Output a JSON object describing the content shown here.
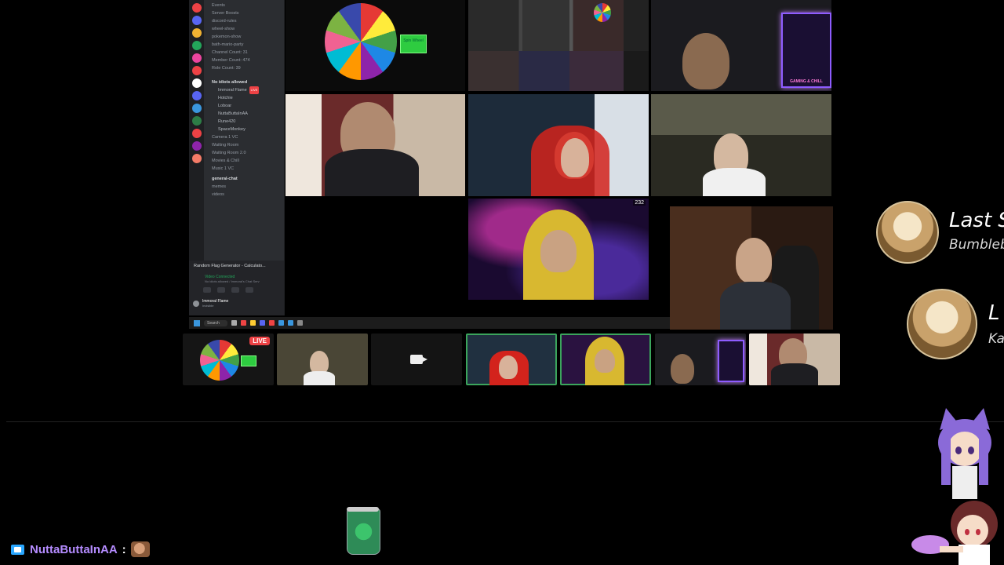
{
  "discord": {
    "channels": [
      "Events",
      "Server Boosts",
      "discord-rules",
      "wheel-show",
      "pokemon-show",
      "bath-mario-party",
      "Channel Count: 31",
      "Member Count: 474",
      "Role Count: 39"
    ],
    "voice_channel": "No idiots allowed",
    "voice_users": [
      "Immoral Flame",
      "Hotchie",
      "Loboar",
      "NuttaButtaInAA",
      "Rune420",
      "SpaceMonkey"
    ],
    "other_channels": [
      "Camera 1 VC",
      "Waiting Room",
      "Waiting Room 2.0",
      "Movies & Chill",
      "Music 1 VC"
    ],
    "text_category": "",
    "text_channels": [
      "general-chat",
      "memes",
      "videos"
    ],
    "live_label": "LIVE",
    "activity": "Random Flag Generator - Calculato...",
    "vc_status": "Video Connected",
    "vc_sub": "No idiots allowed / Immoral's Chat Serv",
    "me_name": "Immoral Flame",
    "me_status": "Invisible"
  },
  "taskbar": {
    "search": "Search"
  },
  "tiles": {
    "wheel_button": "Spin Wheel",
    "viewer_count": "232",
    "sign_text": "GAMING & CHILL"
  },
  "strip": {
    "live_label": "LIVE"
  },
  "events": [
    {
      "title": "Last S",
      "subtitle": "Bumblebe"
    },
    {
      "title": "L",
      "subtitle": "Ka"
    }
  ],
  "chat": {
    "username": "NuttaButtaInAA",
    "separator": ":"
  },
  "colors": {
    "speaking": "#3ba55c",
    "live": "#ed4245",
    "chat_name": "#b58cff"
  }
}
